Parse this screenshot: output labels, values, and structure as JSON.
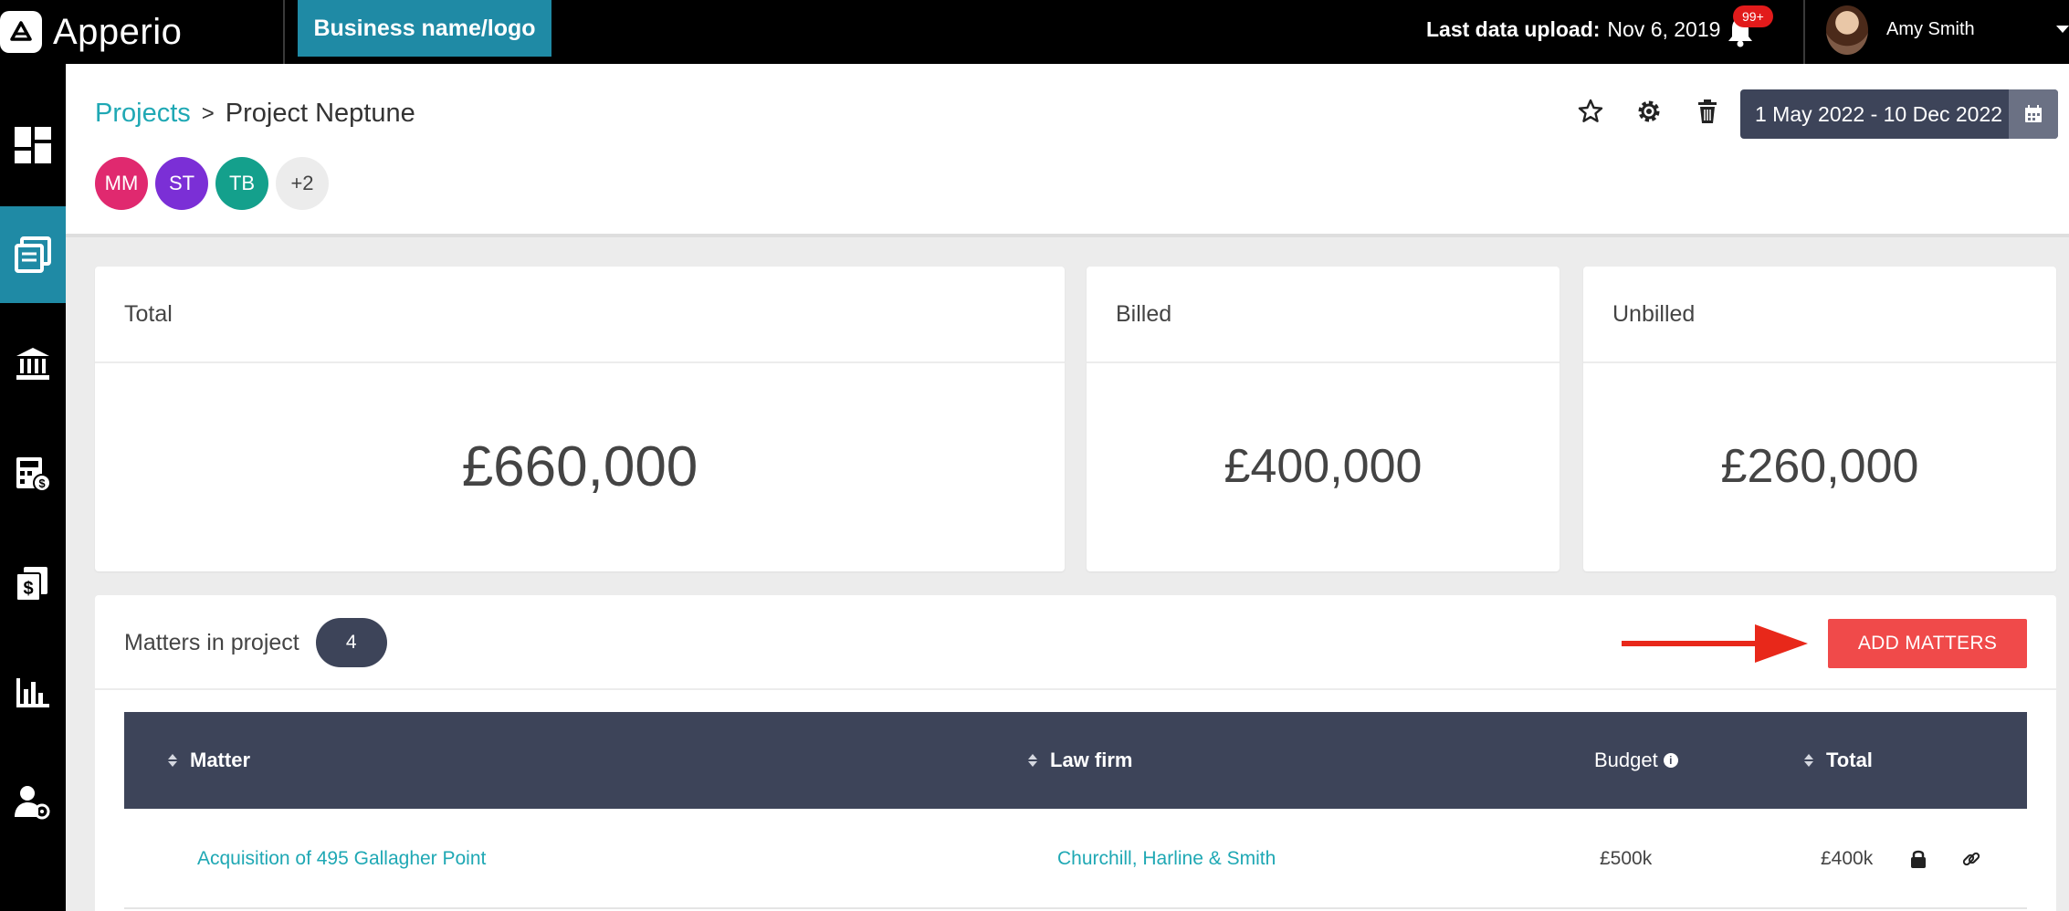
{
  "app": {
    "name": "Apperio",
    "business_badge": "Business name/logo"
  },
  "topbar": {
    "last_upload_label": "Last data upload:",
    "last_upload_value": "Nov 6, 2019",
    "notification_count": "99+",
    "user_name": "Amy Smith"
  },
  "sidebar": {
    "items": [
      {
        "icon": "dashboard-icon",
        "active": false
      },
      {
        "icon": "projects-icon",
        "active": true
      },
      {
        "icon": "bank-icon",
        "active": false
      },
      {
        "icon": "calculator-icon",
        "active": false
      },
      {
        "icon": "invoices-icon",
        "active": false
      },
      {
        "icon": "reports-chart-icon",
        "active": false
      },
      {
        "icon": "user-settings-icon",
        "active": false
      }
    ]
  },
  "breadcrumb": {
    "parent": "Projects",
    "separator": ">",
    "current": "Project Neptune"
  },
  "members": [
    {
      "initials": "MM",
      "color": "#e0296f"
    },
    {
      "initials": "ST",
      "color": "#7b2fd6"
    },
    {
      "initials": "TB",
      "color": "#14a08c"
    },
    {
      "initials": "+2",
      "color": "#ececec"
    }
  ],
  "date_range": "1 May 2022 - 10 Dec 2022",
  "summary": {
    "total_label": "Total",
    "total_value": "£660,000",
    "billed_label": "Billed",
    "billed_value": "£400,000",
    "unbilled_label": "Unbilled",
    "unbilled_value": "£260,000"
  },
  "matters": {
    "title": "Matters in project",
    "count": "4",
    "add_button": "ADD MATTERS",
    "columns": {
      "matter": "Matter",
      "law_firm": "Law firm",
      "budget": "Budget",
      "total": "Total"
    },
    "rows": [
      {
        "matter": "Acquisition of 495 Gallagher Point",
        "law_firm": "Churchill, Harline & Smith",
        "budget": "£500k",
        "total": "£400k"
      }
    ]
  },
  "colors": {
    "accent": "#1fa8b4",
    "header_dark": "#3d4459",
    "add_button": "#f04a4a",
    "active_nav": "#1f8aa5"
  }
}
